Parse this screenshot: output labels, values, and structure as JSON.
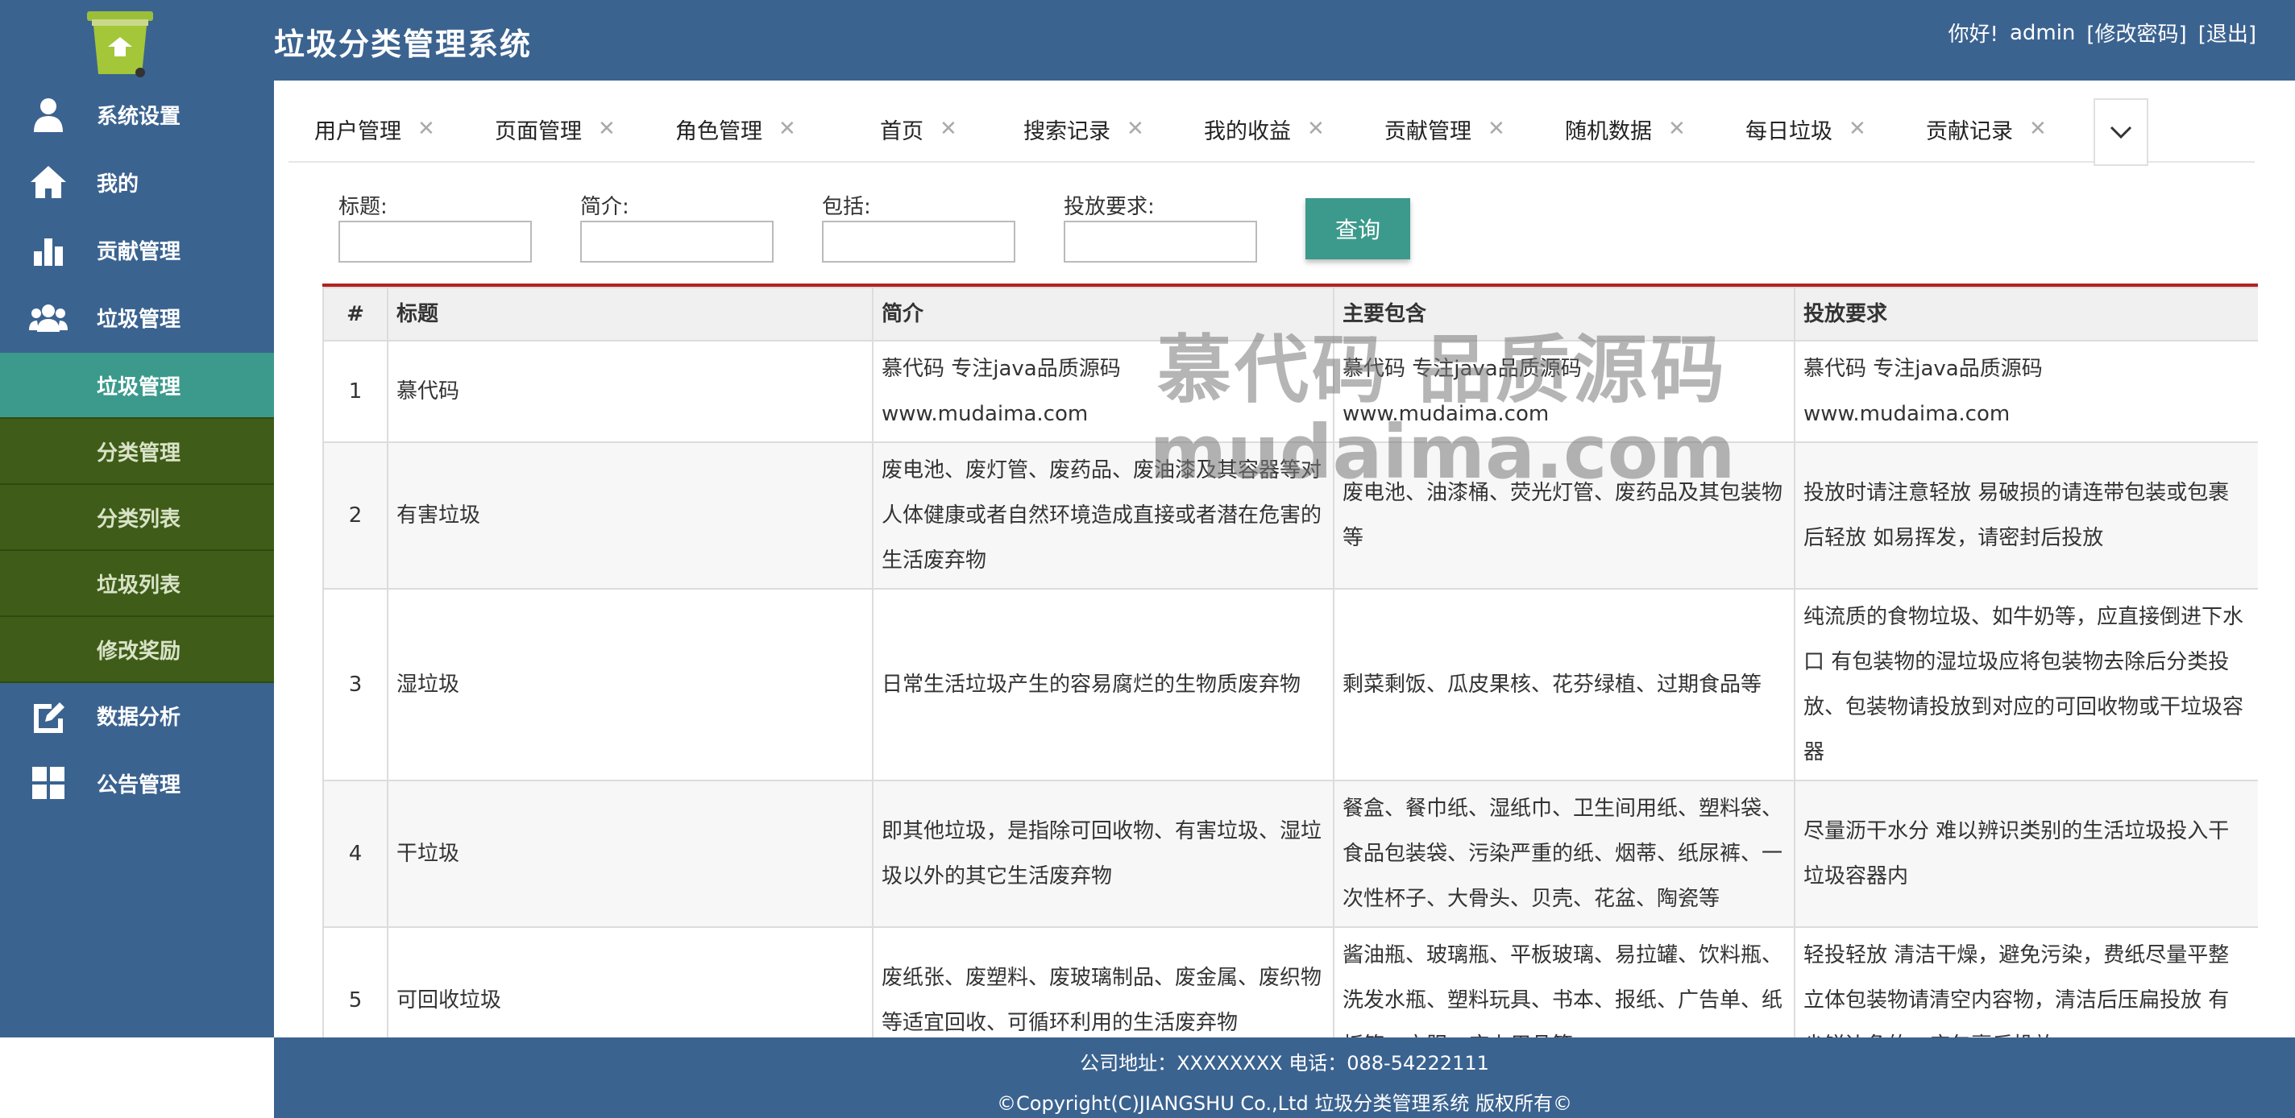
{
  "header": {
    "title": "垃圾分类管理系统",
    "greeting": "你好!",
    "username": "admin",
    "change_password": "[修改密码]",
    "logout": "[退出]"
  },
  "sidebar": {
    "items": [
      {
        "label": "系统设置",
        "icon": "user-settings-icon"
      },
      {
        "label": "我的",
        "icon": "home-icon"
      },
      {
        "label": "贡献管理",
        "icon": "bar-chart-icon"
      },
      {
        "label": "垃圾管理",
        "icon": "group-icon"
      }
    ],
    "subitems": [
      {
        "label": "垃圾管理",
        "active": true
      },
      {
        "label": "分类管理"
      },
      {
        "label": "分类列表"
      },
      {
        "label": "垃圾列表"
      },
      {
        "label": "修改奖励"
      }
    ],
    "items_after": [
      {
        "label": "数据分析",
        "icon": "edit-chart-icon"
      },
      {
        "label": "公告管理",
        "icon": "grid-icon"
      }
    ]
  },
  "tabs": [
    "用户管理",
    "页面管理",
    "角色管理",
    "首页",
    "搜索记录",
    "我的收益",
    "贡献管理",
    "随机数据",
    "每日垃圾",
    "贡献记录"
  ],
  "filters": {
    "title_label": "标题:",
    "intro_label": "简介:",
    "include_label": "包括:",
    "requirement_label": "投放要求:",
    "query_button": "查询"
  },
  "table": {
    "headers": [
      "#",
      "标题",
      "简介",
      "主要包含",
      "投放要求"
    ],
    "rows": [
      {
        "no": "1",
        "title": "慕代码",
        "intro": "慕代码 专注java品质源码 www.mudaima.com",
        "contains": "慕代码 专注java品质源码 www.mudaima.com",
        "requirement": "慕代码 专注java品质源码 www.mudaima.com"
      },
      {
        "no": "2",
        "title": "有害垃圾",
        "intro": "废电池、废灯管、废药品、废油漆及其容器等对人体健康或者自然环境造成直接或者潜在危害的生活废弃物",
        "contains": "废电池、油漆桶、荧光灯管、废药品及其包装物等",
        "requirement": "投放时请注意轻放 易破损的请连带包装或包裹后轻放 如易挥发，请密封后投放"
      },
      {
        "no": "3",
        "title": "湿垃圾",
        "intro": "日常生活垃圾产生的容易腐烂的生物质废弃物",
        "contains": "剩菜剩饭、瓜皮果核、花芬绿植、过期食品等",
        "requirement": "纯流质的食物垃圾、如牛奶等，应直接倒进下水口 有包装物的湿垃圾应将包装物去除后分类投放、包装物请投放到对应的可回收物或干垃圾容器"
      },
      {
        "no": "4",
        "title": "干垃圾",
        "intro": "即其他垃圾，是指除可回收物、有害垃圾、湿垃圾以外的其它生活废弃物",
        "contains": "餐盒、餐巾纸、湿纸巾、卫生间用纸、塑料袋、食品包装袋、污染严重的纸、烟蒂、纸尿裤、一次性杯子、大骨头、贝壳、花盆、陶瓷等",
        "requirement": "尽量沥干水分 难以辨识类别的生活垃圾投入干垃圾容器内"
      },
      {
        "no": "5",
        "title": "可回收垃圾",
        "intro": "废纸张、废塑料、废玻璃制品、废金属、废织物等适宜回收、可循环利用的生活废弃物",
        "contains": "酱油瓶、玻璃瓶、平板玻璃、易拉罐、饮料瓶、洗发水瓶、塑料玩具、书本、报纸、广告单、纸板箱、衣服、床上用品等",
        "requirement": "轻投轻放 清洁干燥，避免污染，费纸尽量平整 立体包装物请清空内容物，清洁后压扁投放 有尖锐边角的，应包裹后投放"
      }
    ]
  },
  "watermark": {
    "line1": "慕代码 品质源码",
    "line2": "mudaima.com"
  },
  "footer": {
    "address": "公司地址：XXXXXXXX 电话：088-54222111",
    "copyright": "©Copyright(C)JIANGSHU Co.,Ltd 垃圾分类管理系统 版权所有©"
  },
  "colors": {
    "primary": "#3b6390",
    "active": "#3c9a8c",
    "submenu": "#3f5c18",
    "accent_line": "#b22222"
  }
}
